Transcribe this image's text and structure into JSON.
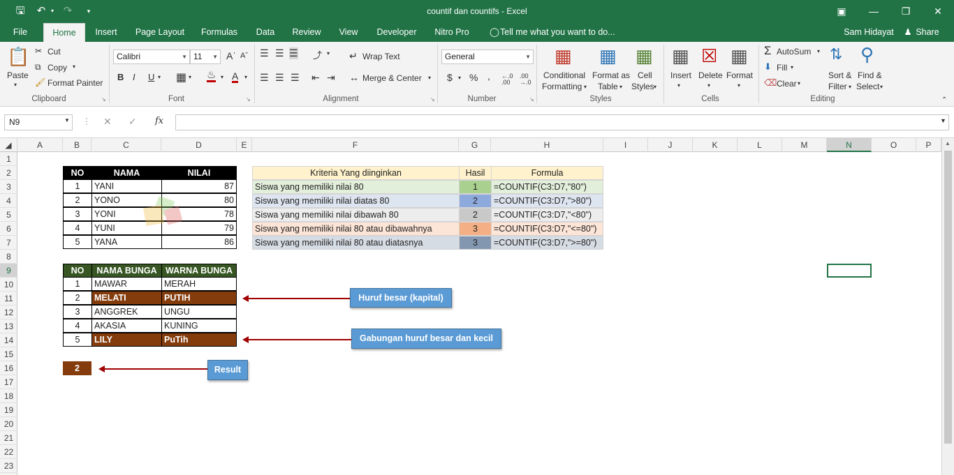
{
  "window": {
    "title": "countif dan countifs - Excel",
    "user": "Sam Hidayat",
    "share": "Share"
  },
  "tabs": [
    "File",
    "Home",
    "Insert",
    "Page Layout",
    "Formulas",
    "Data",
    "Review",
    "View",
    "Developer",
    "Nitro Pro"
  ],
  "tellme": "Tell me what you want to do...",
  "ribbon": {
    "clipboard": {
      "paste": "Paste",
      "cut": "Cut",
      "copy": "Copy",
      "format_painter": "Format Painter",
      "label": "Clipboard"
    },
    "font": {
      "name": "Calibri",
      "size": "11",
      "label": "Font",
      "bold": "B",
      "italic": "I",
      "underline": "U"
    },
    "alignment": {
      "wrap": "Wrap Text",
      "merge": "Merge & Center",
      "label": "Alignment"
    },
    "number": {
      "format": "General",
      "label": "Number",
      "currency": "$",
      "percent": "%",
      "comma": ","
    },
    "styles": {
      "conditional1": "Conditional",
      "conditional2": "Formatting",
      "table1": "Format as",
      "table2": "Table",
      "cell1": "Cell",
      "cell2": "Styles",
      "label": "Styles"
    },
    "cells": {
      "insert": "Insert",
      "delete": "Delete",
      "format": "Format",
      "label": "Cells"
    },
    "editing": {
      "autosum": "AutoSum",
      "fill": "Fill",
      "clear": "Clear",
      "sort1": "Sort &",
      "sort2": "Filter",
      "find1": "Find &",
      "find2": "Select",
      "label": "Editing"
    }
  },
  "formula_bar": {
    "namebox": "N9",
    "fx": "fx",
    "value": ""
  },
  "columns": [
    "A",
    "B",
    "C",
    "D",
    "E",
    "F",
    "G",
    "H",
    "I",
    "J",
    "K",
    "L",
    "M",
    "N",
    "O",
    "P"
  ],
  "rows": [
    "1",
    "2",
    "3",
    "4",
    "5",
    "6",
    "7",
    "8",
    "9",
    "10",
    "11",
    "12",
    "13",
    "14",
    "15",
    "16",
    "17",
    "18",
    "19",
    "20",
    "21",
    "22",
    "23"
  ],
  "table1": {
    "headers": [
      "NO",
      "NAMA",
      "NILAI"
    ],
    "rows": [
      [
        "1",
        "YANI",
        "87"
      ],
      [
        "2",
        "YONO",
        "80"
      ],
      [
        "3",
        "YONI",
        "78"
      ],
      [
        "4",
        "YUNI",
        "79"
      ],
      [
        "5",
        "YANA",
        "86"
      ]
    ]
  },
  "table2": {
    "headers": [
      "NO",
      "NAMA BUNGA",
      "WARNA BUNGA"
    ],
    "rows": [
      [
        "1",
        "MAWAR",
        "MERAH"
      ],
      [
        "2",
        "MELATI",
        "PUTIH"
      ],
      [
        "3",
        "ANGGREK",
        "UNGU"
      ],
      [
        "4",
        "AKASIA",
        "KUNING"
      ],
      [
        "5",
        "LILY",
        "PuTih"
      ]
    ]
  },
  "result": "2",
  "criteria_table": {
    "headers": [
      "Kriteria Yang diinginkan",
      "Hasil",
      "Formula"
    ],
    "rows": [
      [
        "Siswa yang memiliki nilai 80",
        "1",
        "=COUNTIF(C3:D7,\"80\")"
      ],
      [
        "Siswa yang memiliki nilai diatas 80",
        "2",
        "=COUNTIF(C3:D7,\">80\")"
      ],
      [
        "Siswa yang memiliki nilai dibawah 80",
        "2",
        "=COUNTIF(C3:D7,\"<80\")"
      ],
      [
        "Siswa yang memiliki nilai 80 atau dibawahnya",
        "3",
        "=COUNTIF(C3:D7,\"<=80\")"
      ],
      [
        "Siswa yang memiliki nilai 80 atau diatasnya",
        "3",
        "=COUNTIF(C3:D7,\">=80\")"
      ]
    ],
    "hasil_colors": [
      "#a9d08e",
      "#8ea9db",
      "#c9c9c9",
      "#f4b084",
      "#8497b0"
    ]
  },
  "callouts": {
    "kapital": "Huruf besar (kapital)",
    "gabungan": "Gabungan huruf besar dan kecil",
    "result": "Result"
  }
}
